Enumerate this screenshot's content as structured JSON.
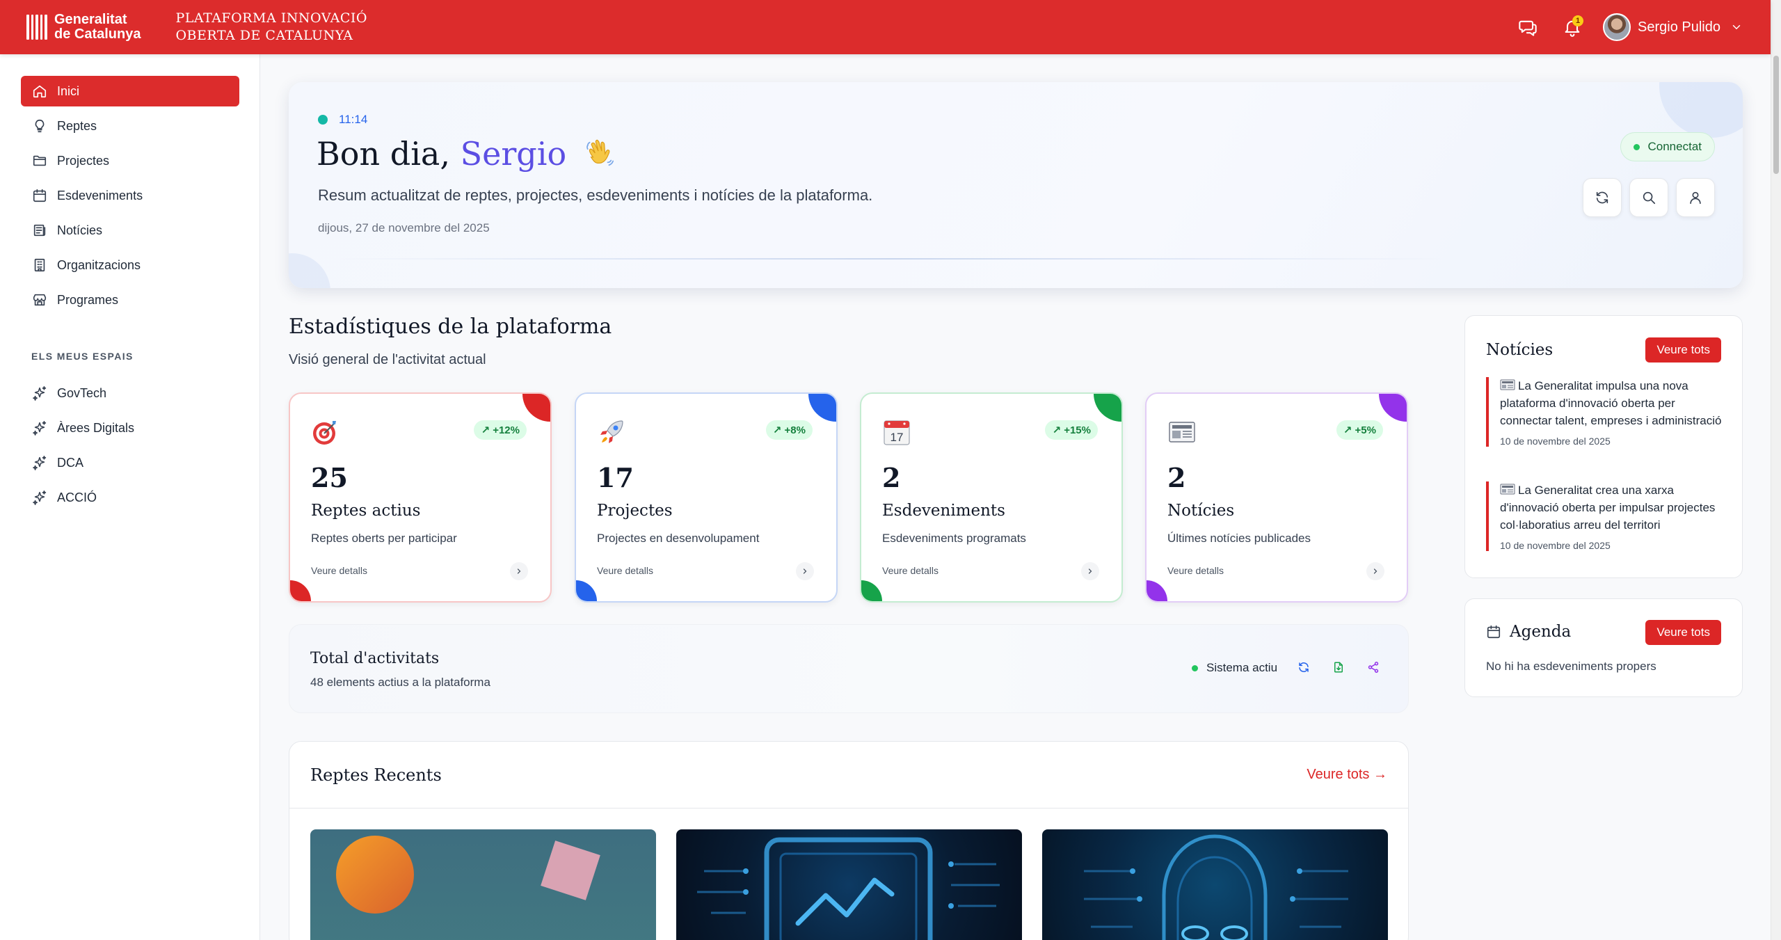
{
  "header": {
    "logo_line1": "Generalitat",
    "logo_line2": "de Catalunya",
    "platform_line1": "PLATAFORMA INNOVACIÓ",
    "platform_line2": "OBERTA DE CATALUNYA",
    "notification_count": "1",
    "user_name": "Sergio Pulido",
    "brand_color": "#dc2c2c"
  },
  "sidebar": {
    "items": [
      {
        "label": "Inici",
        "icon": "home-icon"
      },
      {
        "label": "Reptes",
        "icon": "lightbulb-icon"
      },
      {
        "label": "Projectes",
        "icon": "folder-icon"
      },
      {
        "label": "Esdeveniments",
        "icon": "calendar-icon"
      },
      {
        "label": "Notícies",
        "icon": "newspaper-icon"
      },
      {
        "label": "Organitzacions",
        "icon": "building-icon"
      },
      {
        "label": "Programes",
        "icon": "store-icon"
      }
    ],
    "section_label": "ELS MEUS ESPAIS",
    "spaces": [
      {
        "label": "GovTech",
        "icon": "sparkles-icon"
      },
      {
        "label": "Àrees Digitals",
        "icon": "sparkles-icon"
      },
      {
        "label": "DCA",
        "icon": "sparkles-icon"
      },
      {
        "label": "ACCIÓ",
        "icon": "sparkles-icon"
      }
    ]
  },
  "hero": {
    "time": "11:14",
    "greeting": "Bon dia,",
    "name": "Sergio",
    "subtitle": "Resum actualitzat de reptes, projectes, esdeveniments i notícies de la plataforma.",
    "date": "dijous, 27 de novembre del 2025",
    "status": "Connectat"
  },
  "stats": {
    "title": "Estadístiques de la plataforma",
    "subtitle": "Visió general de l'activitat actual",
    "cards": [
      {
        "value": "25",
        "label": "Reptes actius",
        "desc": "Reptes oberts per participar",
        "trend": "+12%",
        "details": "Veure detalls",
        "color": "#dc2626",
        "icon": "target-icon"
      },
      {
        "value": "17",
        "label": "Projectes",
        "desc": "Projectes en desenvolupament",
        "trend": "+8%",
        "details": "Veure detalls",
        "color": "#2563eb",
        "icon": "rocket-icon"
      },
      {
        "value": "2",
        "label": "Esdeveniments",
        "desc": "Esdeveniments programats",
        "trend": "+15%",
        "details": "Veure detalls",
        "color": "#16a34a",
        "icon": "calendar-17-icon"
      },
      {
        "value": "2",
        "label": "Notícies",
        "desc": "Últimes notícies publicades",
        "trend": "+5%",
        "details": "Veure detalls",
        "color": "#9333ea",
        "icon": "newspaper-icon"
      }
    ]
  },
  "total": {
    "title": "Total d'activitats",
    "subtitle": "48 elements actius a la plataforma",
    "status": "Sistema actiu"
  },
  "recent": {
    "title": "Reptes Recents",
    "view_all": "Veure tots →"
  },
  "news": {
    "title": "Notícies",
    "view_all": "Veure tots",
    "items": [
      {
        "text": "La Generalitat impulsa una nova plataforma d'innovació oberta per connectar talent, empreses i administració",
        "date": "10 de novembre del 2025"
      },
      {
        "text": "La Generalitat crea una xarxa d'innovació oberta per impulsar projectes col·laboratius arreu del territori",
        "date": "10 de novembre del 2025"
      }
    ]
  },
  "agenda": {
    "title": "Agenda",
    "view_all": "Veure tots",
    "empty": "No hi ha esdeveniments propers"
  }
}
